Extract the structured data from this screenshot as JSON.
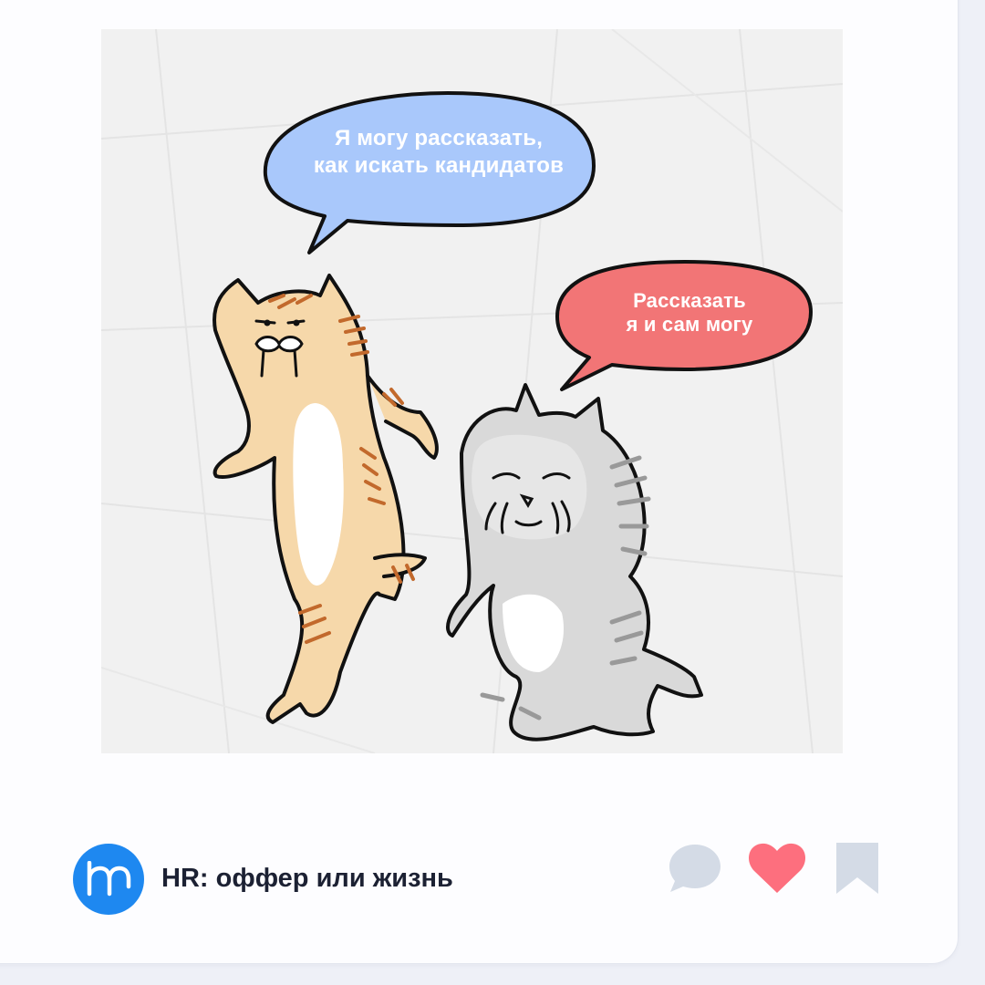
{
  "post": {
    "bubble_top_line1": "Я могу рассказать,",
    "bubble_top_line2": "как искать кандидатов",
    "bubble_bottom_line1": "Рассказать",
    "bubble_bottom_line2": "я и сам могу"
  },
  "channel": {
    "name": "HR: оффер или жизнь",
    "avatar_icon": "hr-logo-icon"
  },
  "actions": {
    "comment_icon": "comment-icon",
    "like_icon": "heart-icon",
    "bookmark_icon": "bookmark-icon"
  },
  "colors": {
    "avatar_bg": "#1e88f0",
    "like": "#fd6f7e",
    "muted_icon": "#d4dbe6",
    "bubble_blue": "#a9c8fb",
    "bubble_red": "#f27576"
  }
}
